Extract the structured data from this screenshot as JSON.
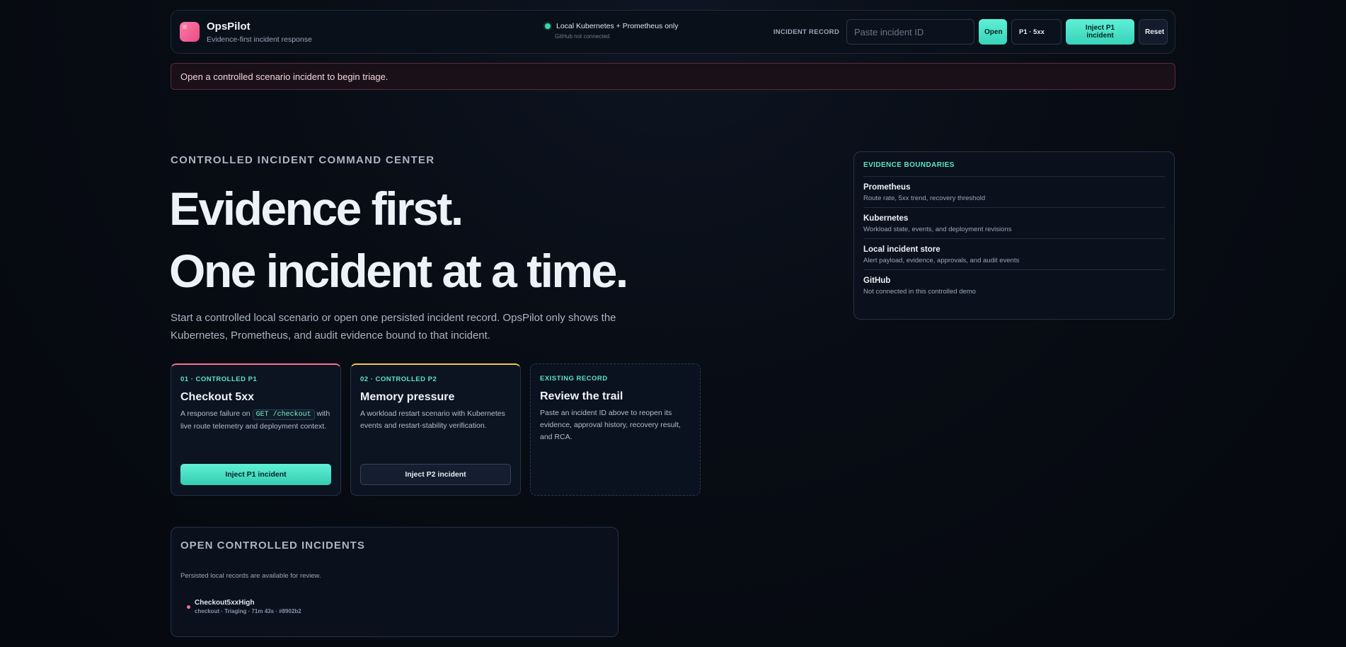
{
  "header": {
    "brand_title": "OpsPilot",
    "brand_subtitle": "Evidence-first incident response",
    "env_status": "Local Kubernetes + Prometheus only",
    "env_substatus": "GitHub not connected",
    "incident_record_label": "INCIDENT RECORD",
    "incident_input_placeholder": "Paste incident ID",
    "open_button": "Open",
    "severity_select": "P1 · 5xx",
    "inject_button": "Inject P1 incident",
    "reset_button": "Reset"
  },
  "banner": {
    "message": "Open a controlled scenario incident to begin triage."
  },
  "hero": {
    "eyebrow": "CONTROLLED INCIDENT COMMAND CENTER",
    "headline_line1": "Evidence first.",
    "headline_line2": "One incident at a time.",
    "lede": "Start a controlled local scenario or open one persisted incident record. OpsPilot only shows the Kubernetes, Prometheus, and audit evidence bound to that incident."
  },
  "cards": [
    {
      "kicker": "01 · CONTROLLED P1",
      "title": "Checkout 5xx",
      "desc_before": "A response failure on",
      "code": "GET /checkout",
      "desc_after": "with live route telemetry and deployment context.",
      "button": "Inject P1 incident"
    },
    {
      "kicker": "02 · CONTROLLED P2",
      "title": "Memory pressure",
      "desc": "A workload restart scenario with Kubernetes events and restart-stability verification.",
      "button": "Inject P2 incident"
    },
    {
      "kicker": "EXISTING RECORD",
      "title": "Review the trail",
      "desc": "Paste an incident ID above to reopen its evidence, approval history, recovery result, and RCA."
    }
  ],
  "evidence": {
    "heading": "EVIDENCE BOUNDARIES",
    "items": [
      {
        "title": "Prometheus",
        "desc": "Route rate, 5xx trend, recovery threshold"
      },
      {
        "title": "Kubernetes",
        "desc": "Workload state, events, and deployment revisions"
      },
      {
        "title": "Local incident store",
        "desc": "Alert payload, evidence, approvals, and audit events"
      },
      {
        "title": "GitHub",
        "desc": "Not connected in this controlled demo"
      }
    ]
  },
  "open_incidents": {
    "title": "OPEN CONTROLLED INCIDENTS",
    "note": "Persisted local records are available for review.",
    "items": [
      {
        "name": "Checkout5xxHigh",
        "meta": "checkout · Triaging · 71m 43s · #8902b2"
      }
    ]
  },
  "colors": {
    "accent_teal": "#5fe3c8",
    "pink": "#ff6f93",
    "yellow": "#f5c542",
    "status_green": "#3fd4a8"
  }
}
